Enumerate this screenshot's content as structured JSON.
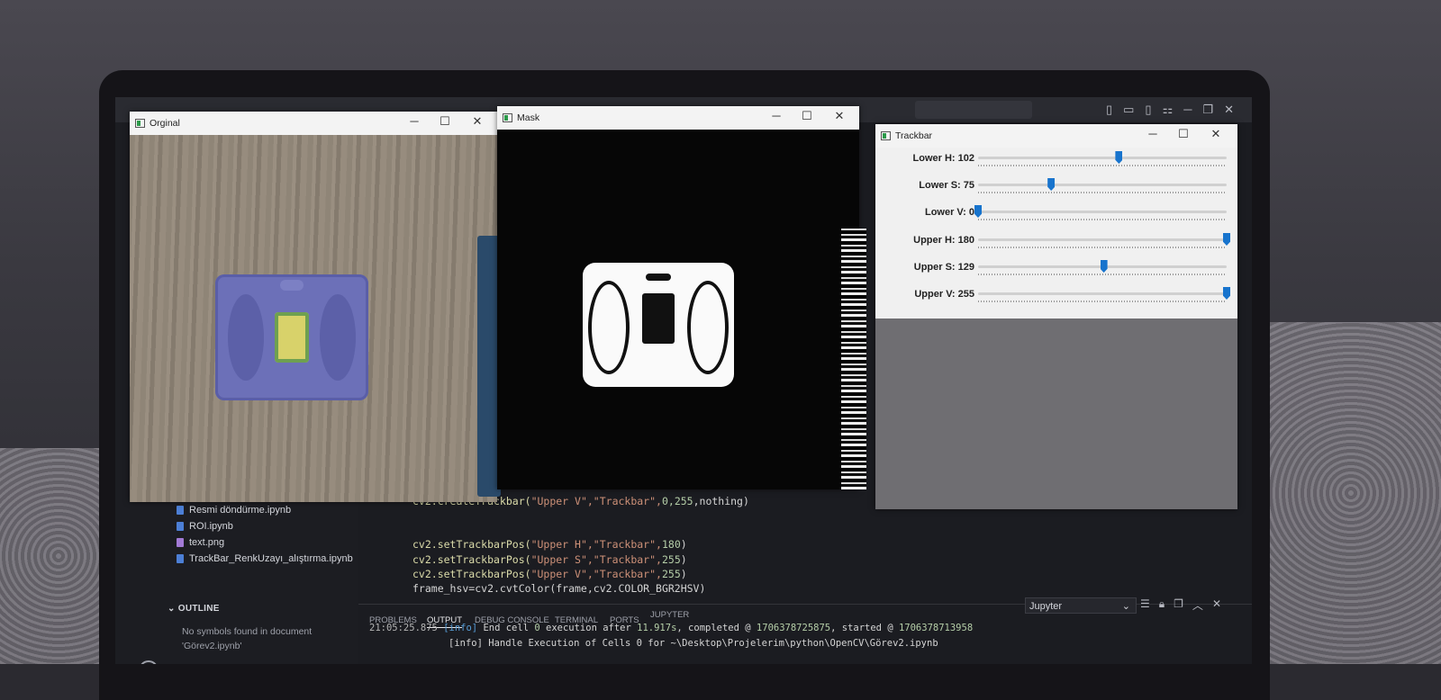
{
  "vscode": {
    "files": [
      "Resmi döndürme.ipynb",
      "ROI.ipynb",
      "text.png",
      "TrackBar_RenkUzayı_alıştırma.ipynb"
    ],
    "outline": {
      "heading": "OUTLINE",
      "message": "No symbols found in document 'Görev2.ipynb'"
    },
    "code": {
      "line1": {
        "fn": "cv2.createTrackbar(",
        "args": "\"Upper V\",\"Trackbar\",",
        "nums": "0,255",
        "rest": ",nothing)"
      },
      "line2": {
        "fn": "cv2.setTrackbarPos(",
        "args": "\"Upper H\",\"Trackbar\",",
        "num": "180",
        "close": ")"
      },
      "line3": {
        "fn": "cv2.setTrackbarPos(",
        "args": "\"Upper S\",\"Trackbar\",",
        "num": "255",
        "close": ")"
      },
      "line4": {
        "fn": "cv2.setTrackbarPos(",
        "args": "\"Upper V\",\"Trackbar\",",
        "num": "255",
        "close": ")"
      },
      "line5": "frame_hsv=cv2.cvtColor(frame,cv2.COLOR_BGR2HSV)"
    },
    "panel_tabs": [
      "PROBLEMS",
      "OUTPUT",
      "DEBUG CONSOLE",
      "TERMINAL",
      "PORTS",
      "JUPYTER"
    ],
    "active_panel_tab": "OUTPUT",
    "output_channel": "Jupyter",
    "log": {
      "timestamp": "21:05:25.875",
      "level": "[info]",
      "text1": " End cell ",
      "cell": "0",
      "text2": " execution after ",
      "duration": "11.917s",
      "text3": ", completed @ ",
      "completed": "1706378725875",
      "text4": ", started @ ",
      "started": "1706378713958",
      "line2": "[info] Handle Execution of Cells 0 for ~\\Desktop\\Projelerim\\python\\OpenCV\\Görev2.ipynb"
    }
  },
  "windows": {
    "original": {
      "title": "Orginal"
    },
    "mask": {
      "title": "Mask"
    },
    "trackbar": {
      "title": "Trackbar"
    }
  },
  "trackbars": [
    {
      "label": "Lower H: 102",
      "value": 102,
      "max": 180
    },
    {
      "label": "Lower S: 75",
      "value": 75,
      "max": 255
    },
    {
      "label": "Lower V: 0",
      "value": 0,
      "max": 255
    },
    {
      "label": "Upper H: 180",
      "value": 180,
      "max": 180
    },
    {
      "label": "Upper S: 129",
      "value": 129,
      "max": 255
    },
    {
      "label": "Upper V: 255",
      "value": 255,
      "max": 255
    }
  ],
  "icons": {
    "minimize": "─",
    "maximize": "☐",
    "close": "✕",
    "panel_actions": [
      "list-icon",
      "lock-icon",
      "copy-icon",
      "chevron-up-icon",
      "close-icon"
    ]
  },
  "colors": {
    "thumb": "#1874cd",
    "vscode_bg": "#1e1f24"
  }
}
